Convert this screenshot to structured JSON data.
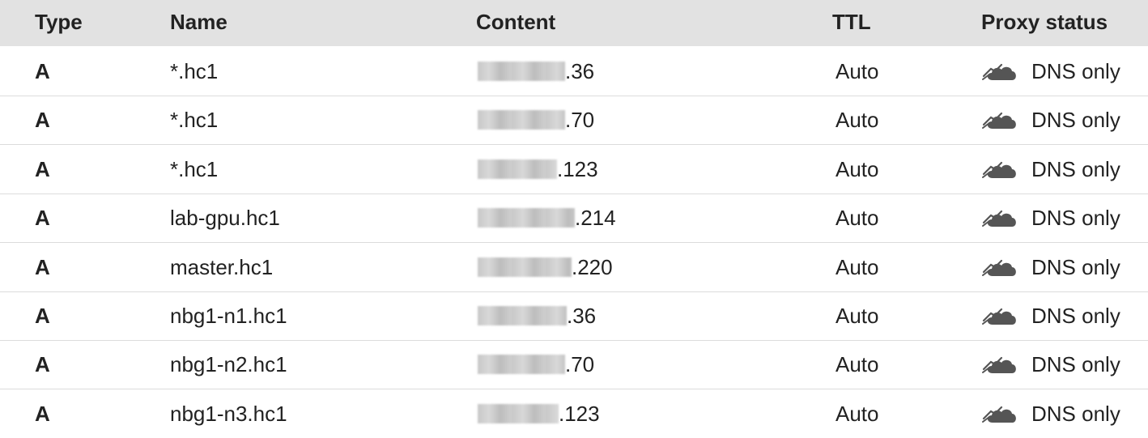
{
  "headers": {
    "type": "Type",
    "name": "Name",
    "content": "Content",
    "ttl": "TTL",
    "proxy": "Proxy status"
  },
  "rows": [
    {
      "type": "A",
      "name": "*.hc1",
      "content_suffix": ".36",
      "ttl": "Auto",
      "proxy": "DNS only"
    },
    {
      "type": "A",
      "name": "*.hc1",
      "content_suffix": ".70",
      "ttl": "Auto",
      "proxy": "DNS only"
    },
    {
      "type": "A",
      "name": "*.hc1",
      "content_suffix": ".123",
      "ttl": "Auto",
      "proxy": "DNS only"
    },
    {
      "type": "A",
      "name": "lab-gpu.hc1",
      "content_suffix": ".214",
      "ttl": "Auto",
      "proxy": "DNS only"
    },
    {
      "type": "A",
      "name": "master.hc1",
      "content_suffix": ".220",
      "ttl": "Auto",
      "proxy": "DNS only"
    },
    {
      "type": "A",
      "name": "nbg1-n1.hc1",
      "content_suffix": ".36",
      "ttl": "Auto",
      "proxy": "DNS only"
    },
    {
      "type": "A",
      "name": "nbg1-n2.hc1",
      "content_suffix": ".70",
      "ttl": "Auto",
      "proxy": "DNS only"
    },
    {
      "type": "A",
      "name": "nbg1-n3.hc1",
      "content_suffix": ".123",
      "ttl": "Auto",
      "proxy": "DNS only"
    }
  ],
  "icons": {
    "proxy": "cloud-dns-only-icon"
  },
  "colors": {
    "header_bg": "#e2e2e2",
    "cloud_icon": "#555555"
  }
}
